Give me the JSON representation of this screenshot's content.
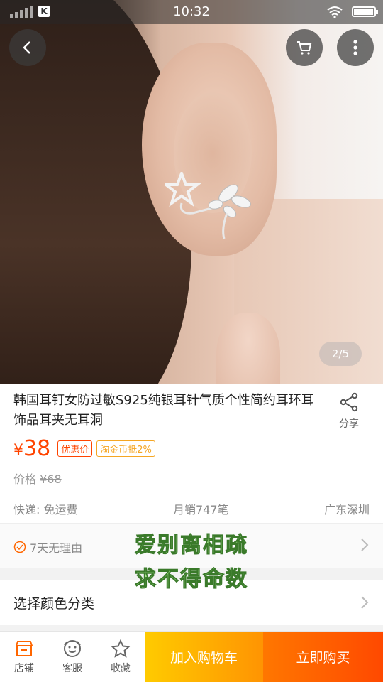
{
  "status_bar": {
    "time": "10:32",
    "carrier_badge": "K",
    "battery_level": 0.95
  },
  "gallery": {
    "counter": "2/5"
  },
  "product": {
    "title": "韩国耳钉女防过敏S925纯银耳针气质个性简约耳环耳饰品耳夹无耳洞",
    "share_label": "分享",
    "price_symbol": "¥",
    "price": "38",
    "promo_tag": "优惠价",
    "coin_tag": "淘金币抵2%",
    "original_price_label": "价格",
    "original_price": "¥68",
    "shipping": "快递: 免运费",
    "monthly_sales": "月销747笔",
    "location": "广东深圳"
  },
  "service": {
    "item": "7天无理由"
  },
  "overlay": {
    "line1": "爱别离相疏",
    "line2": "求不得命数"
  },
  "sku": {
    "label": "选择颜色分类"
  },
  "bottom_bar": {
    "store_label": "店铺",
    "service_label": "客服",
    "favorite_label": "收藏",
    "add_cart_label": "加入购物车",
    "buy_now_label": "立即购买"
  },
  "colors": {
    "accent": "#ff4400",
    "cart_button": "#ff9402",
    "buy_button": "#ff4900",
    "coin": "#f5a623"
  },
  "icons": [
    "back-icon",
    "cart-icon",
    "more-icon",
    "share-icon",
    "check-circle-icon",
    "chevron-right-icon",
    "store-icon",
    "customer-service-icon",
    "star-icon"
  ]
}
